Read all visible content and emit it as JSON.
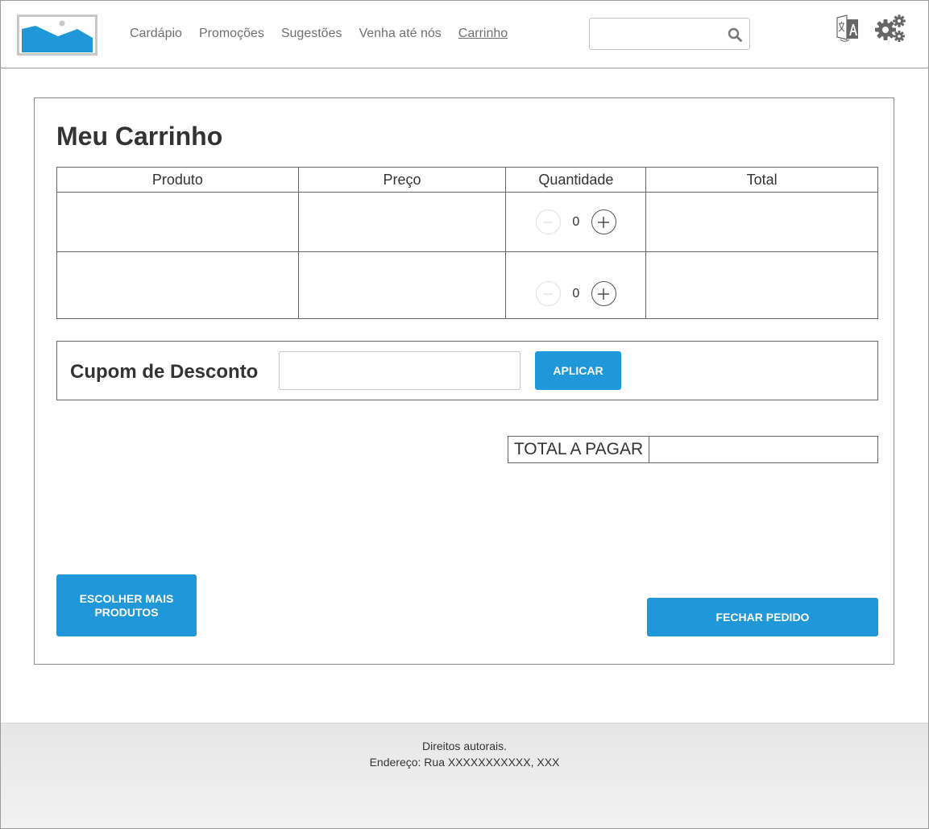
{
  "header": {
    "nav": [
      {
        "label": "Cardápio"
      },
      {
        "label": "Promoções"
      },
      {
        "label": "Sugestões"
      },
      {
        "label": "Venha até nós"
      },
      {
        "label": "Carrinho",
        "active": true
      }
    ],
    "search": {
      "placeholder": "",
      "value": ""
    }
  },
  "cart": {
    "title": "Meu Carrinho",
    "columns": [
      "Produto",
      "Preço",
      "Quantidade",
      "Total"
    ],
    "rows": [
      {
        "product": "",
        "price": "",
        "quantity": "0",
        "total": ""
      },
      {
        "product": "",
        "price": "",
        "quantity": "0",
        "total": ""
      }
    ]
  },
  "coupon": {
    "label": "Cupom de Desconto",
    "value": "",
    "apply_label": "APLICAR"
  },
  "total": {
    "label": "TOTAL A PAGAR",
    "value": ""
  },
  "actions": {
    "more_label": "ESCOLHER MAIS PRODUTOS",
    "close_label": "FECHAR PEDIDO"
  },
  "footer": {
    "line1": "Direitos autorais.",
    "line2": "Endereço: Rua XXXXXXXXXXX, XXX"
  },
  "colors": {
    "accent": "#1f97d9",
    "icon_gray": "#666666"
  }
}
